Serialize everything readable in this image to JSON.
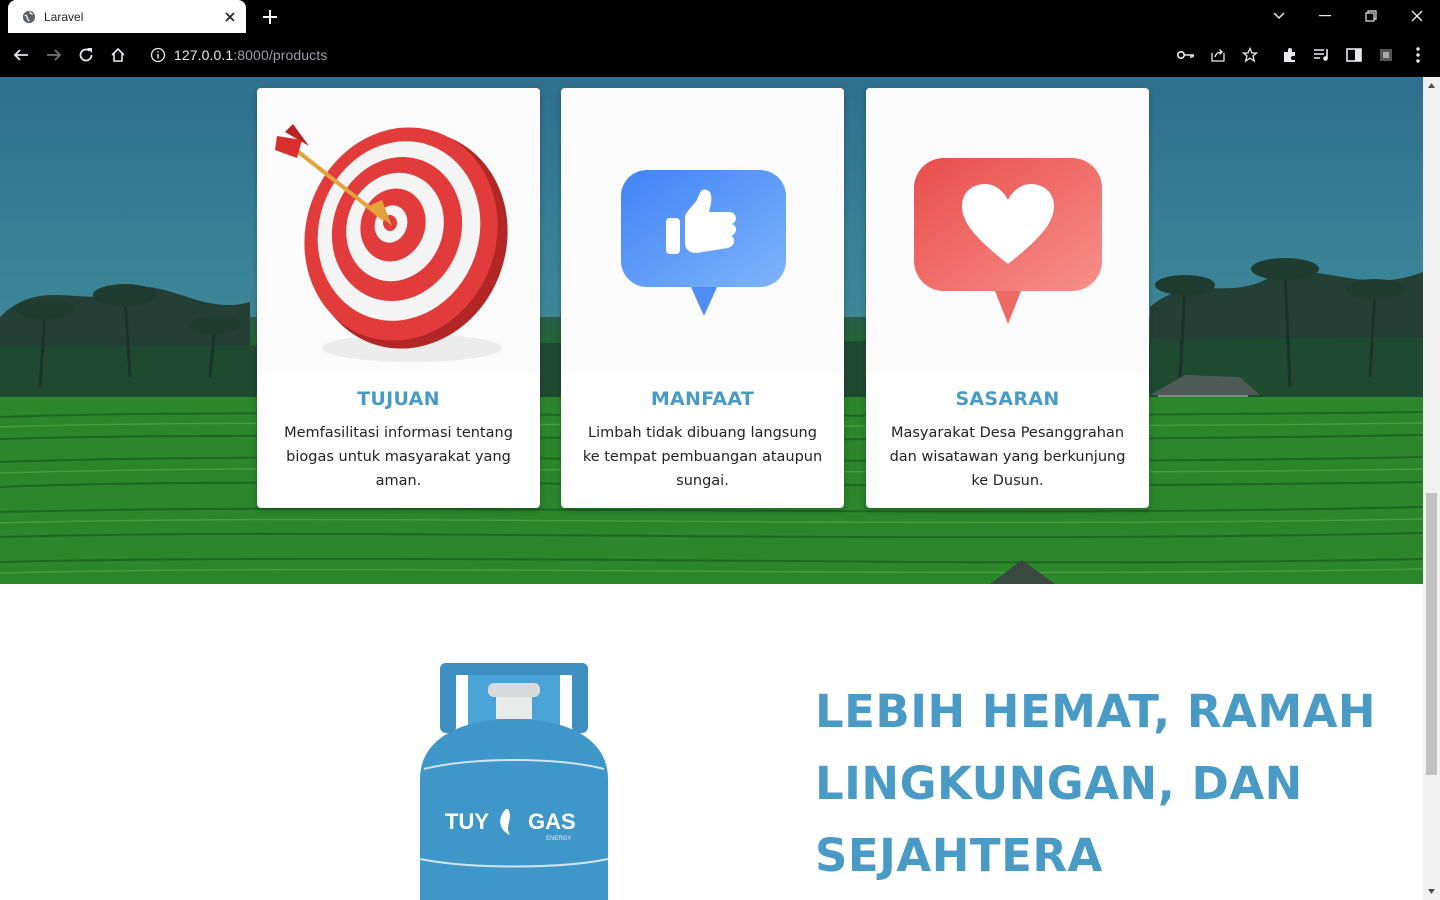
{
  "browser": {
    "tab_title": "Laravel",
    "url_host": "127.0.0.1",
    "url_path": ":8000/products"
  },
  "cards": [
    {
      "title": "TUJUAN",
      "text": "Memfasilitasi informasi tentang biogas untuk masyarakat yang aman.",
      "icon": "target-icon"
    },
    {
      "title": "MANFAAT",
      "text": "Limbah tidak dibuang langsung ke tempat pembuangan ataupun sungai.",
      "icon": "thumbs-up-icon"
    },
    {
      "title": "SASARAN",
      "text": "Masyarakat Desa Pesanggrahan dan wisatawan yang berkunjung ke Dusun.",
      "icon": "heart-bubble-icon"
    }
  ],
  "promo": {
    "heading": "LEBIH HEMAT, RAMAH LINGKUNGAN, DAN SEJAHTERA",
    "tank_brand": "TUY",
    "tank_brand_2": "GAS",
    "tank_sub": "ENERGY"
  },
  "colors": {
    "accent": "#4a9ac6",
    "chrome": "#000000",
    "tank": "#3f96c8"
  }
}
